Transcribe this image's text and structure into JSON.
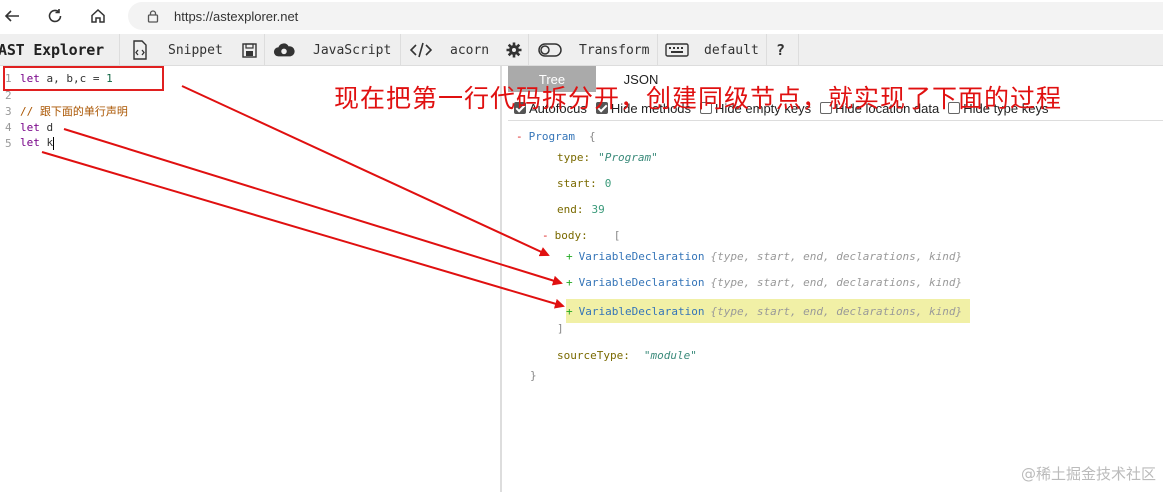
{
  "browser": {
    "url": "https://astexplorer.net"
  },
  "toolbar": {
    "title": "AST Explorer",
    "snippet_label": "Snippet",
    "language_label": "JavaScript",
    "parser_label": "acorn",
    "transform_label": "Transform",
    "keymap_label": "default",
    "help_label": "?"
  },
  "editor": {
    "lines": [
      {
        "num": "1",
        "kw": "let",
        "rest": " a, b,c = ",
        "num_val": "1"
      },
      {
        "num": "2",
        "text": ""
      },
      {
        "num": "3",
        "comment": "// 跟下面的单行声明"
      },
      {
        "num": "4",
        "kw": "let",
        "rest": " d"
      },
      {
        "num": "5",
        "kw": "let",
        "rest": " k"
      }
    ]
  },
  "panel": {
    "tabs": [
      "Tree",
      "JSON"
    ],
    "options": [
      {
        "label": "Autofocus",
        "checked": true
      },
      {
        "label": "Hide methods",
        "checked": true
      },
      {
        "label": "Hide empty keys",
        "checked": false
      },
      {
        "label": "Hide location data",
        "checked": false
      },
      {
        "label": "Hide type keys",
        "checked": false
      }
    ]
  },
  "tree": {
    "root": "Program",
    "open_brace": "{",
    "close_brace": "}",
    "type_key": "type:",
    "type_val": "\"Program\"",
    "start_key": "start:",
    "start_val": "0",
    "end_key": "end:",
    "end_val": "39",
    "body_key": "body:",
    "open_bracket": "[",
    "close_bracket": "]",
    "body_items": [
      {
        "name": "VariableDeclaration",
        "summary": "{type, start, end, declarations, kind}"
      },
      {
        "name": "VariableDeclaration",
        "summary": "{type, start, end, declarations, kind}"
      },
      {
        "name": "VariableDeclaration",
        "summary": "{type, start, end, declarations, kind}"
      }
    ],
    "source_key": "sourceType:",
    "source_val": "\"module\""
  },
  "annotation": {
    "text": "现在把第一行代码拆分开，创建同级节点，就实现了下面的过程",
    "color": "#e01010"
  },
  "watermark": "@稀土掘金技术社区"
}
